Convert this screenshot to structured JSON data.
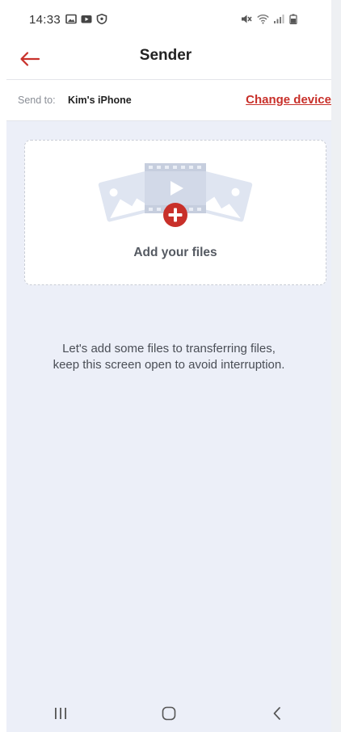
{
  "status_bar": {
    "time": "14:33",
    "left_icons": [
      "gallery-icon",
      "youtube-icon",
      "shield-icon"
    ],
    "right_icons": [
      "mute-icon",
      "wifi-icon",
      "signal-icon",
      "battery-icon"
    ]
  },
  "app_bar": {
    "title": "Sender",
    "back_icon": "arrow-left-icon"
  },
  "send_to": {
    "label": "Send to:",
    "device": "Kim's iPhone",
    "change_label": "Change device"
  },
  "add_card": {
    "label": "Add your files",
    "icon": "add-files-illustration"
  },
  "hint": {
    "line1": "Let's add some files to transferring files,",
    "line2": "keep this screen open to avoid interruption."
  },
  "nav": {
    "recents_icon": "recents-icon",
    "home_icon": "home-icon",
    "back_icon": "back-chevron-icon"
  },
  "colors": {
    "accent": "#c8302a",
    "content_bg": "#eceff8",
    "illustration": "#dfe5f1"
  }
}
